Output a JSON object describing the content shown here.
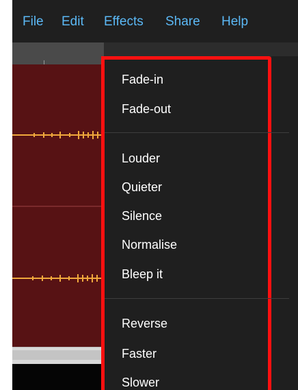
{
  "menubar": {
    "items": [
      "File",
      "Edit",
      "Effects",
      "Share",
      "Help"
    ]
  },
  "effects_menu": {
    "groups": [
      [
        "Fade-in",
        "Fade-out"
      ],
      [
        "Louder",
        "Quieter",
        "Silence",
        "Normalise",
        "Bleep it"
      ],
      [
        "Reverse",
        "Faster",
        "Slower"
      ]
    ]
  },
  "colors": {
    "menubar_bg": "#1f1f1f",
    "menu_text": "#5bb8f5",
    "track_bg": "#571214",
    "waveform": "#f0a83c",
    "highlight_border": "#ff1010"
  }
}
